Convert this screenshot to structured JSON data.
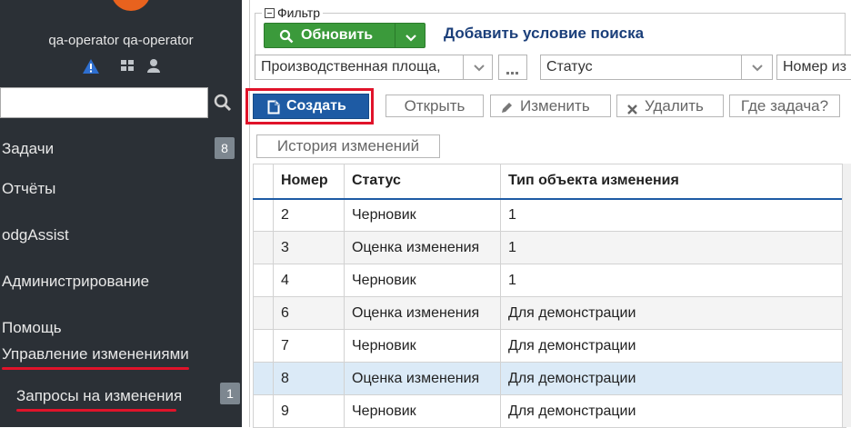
{
  "sidebar": {
    "user_name": "qa-operator qa-operator",
    "search": {
      "placeholder": "",
      "value": ""
    },
    "items": [
      {
        "label": "Задачи",
        "badge": "8"
      },
      {
        "label": "Отчёты"
      },
      {
        "label": "odgAssist"
      },
      {
        "label": "Администрирование"
      },
      {
        "label": "Помощь"
      },
      {
        "label": "Управление изменениями"
      },
      {
        "label": "Запросы на изменения",
        "badge": "1"
      }
    ],
    "icons": [
      "warning-icon",
      "grid-icon",
      "user-icon",
      "search-icon"
    ]
  },
  "filter": {
    "legend": "Фильтр",
    "refresh_label": "Обновить",
    "add_condition": "Добавить условие поиска",
    "combos": [
      {
        "value": "Производственная площа,"
      },
      {
        "value": "Статус"
      },
      {
        "value": "Номер из"
      }
    ]
  },
  "toolbar": {
    "create": "Создать",
    "open": "Открыть",
    "edit": "Изменить",
    "delete": "Удалить",
    "where_task": "Где задача?",
    "history": "История изменений"
  },
  "table": {
    "columns": [
      "Номер",
      "Статус",
      "Тип объекта изменения"
    ],
    "rows": [
      {
        "num": "2",
        "status": "Черновик",
        "type": "1"
      },
      {
        "num": "3",
        "status": "Оценка изменения",
        "type": "1"
      },
      {
        "num": "4",
        "status": "Черновик",
        "type": "1"
      },
      {
        "num": "6",
        "status": "Оценка изменения",
        "type": "Для демонстрации"
      },
      {
        "num": "7",
        "status": "Черновик",
        "type": "Для демонстрации"
      },
      {
        "num": "8",
        "status": "Оценка изменения",
        "type": "Для демонстрации"
      },
      {
        "num": "9",
        "status": "Черновик",
        "type": "Для демонстрации"
      }
    ]
  },
  "colors": {
    "sidebar_bg": "#2b3036",
    "accent_green": "#3b9a3b",
    "accent_blue": "#1e5ba4",
    "highlight_red": "#e0132a",
    "selected_row": "#dbeaf7"
  }
}
